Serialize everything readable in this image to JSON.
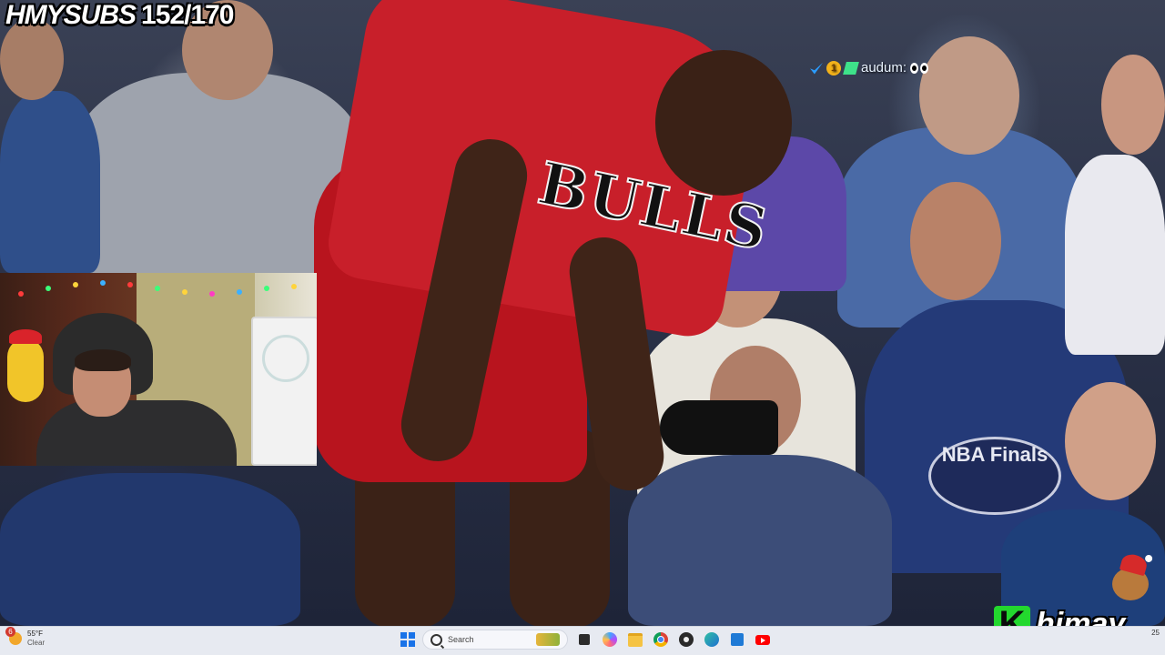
{
  "overlay": {
    "brand": "HMYSUBS",
    "sub_count": "152/170",
    "chat": {
      "username": "audum:"
    },
    "channel_logo": {
      "letter": "K",
      "name": "himay"
    }
  },
  "scene": {
    "jersey_text": "BULLS",
    "logo_text": "NBA Finals"
  },
  "taskbar": {
    "weather": {
      "badge": "6",
      "temp": "55°F",
      "condition": "Clear"
    },
    "search": {
      "placeholder": "Search"
    },
    "clock": "25",
    "pinned": [
      "task-view",
      "copilot",
      "file-explorer",
      "chrome",
      "obs",
      "edge",
      "microsoft-store",
      "youtube"
    ]
  },
  "colors": {
    "accent_green": "#23d82e",
    "jersey_red": "#c81f2a"
  }
}
